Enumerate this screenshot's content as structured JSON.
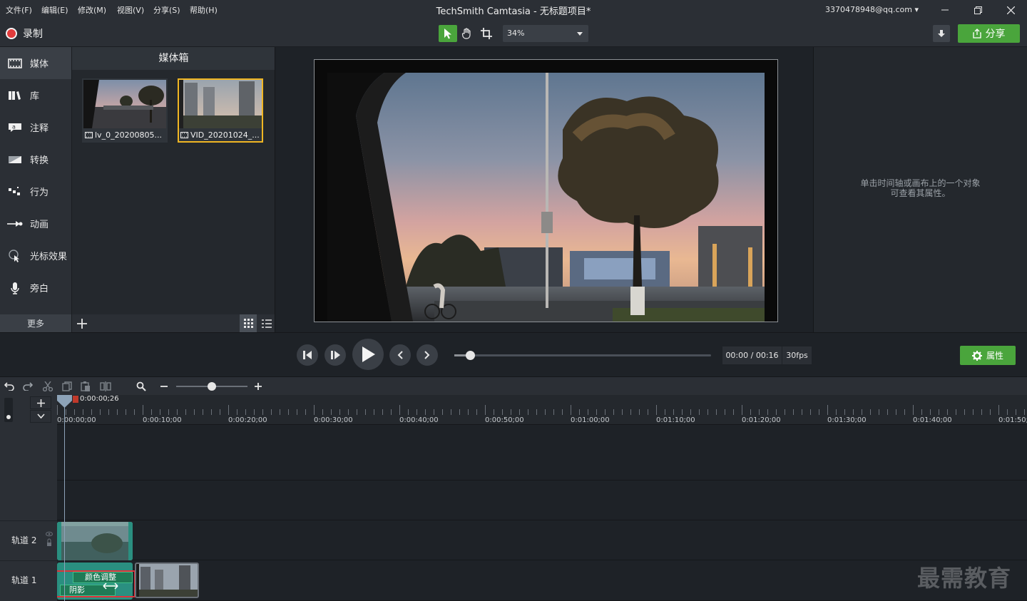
{
  "menubar": {
    "items": [
      "文件(F)",
      "编辑(E)",
      "修改(M)",
      "视图(V)",
      "分享(S)",
      "帮助(H)"
    ],
    "title": "TechSmith Camtasia - 无标题项目*",
    "account": "3370478948@qq.com"
  },
  "toolbar": {
    "record_label": "录制",
    "zoom_value": "34%",
    "share_label": "分享"
  },
  "sidebar": {
    "items": [
      {
        "label": "媒体",
        "icon": "media-icon"
      },
      {
        "label": "库",
        "icon": "library-icon"
      },
      {
        "label": "注释",
        "icon": "annotation-icon"
      },
      {
        "label": "转换",
        "icon": "transition-icon"
      },
      {
        "label": "行为",
        "icon": "behavior-icon"
      },
      {
        "label": "动画",
        "icon": "animation-icon"
      },
      {
        "label": "光标效果",
        "icon": "cursor-effect-icon"
      },
      {
        "label": "旁白",
        "icon": "microphone-icon"
      }
    ],
    "more_label": "更多"
  },
  "media_bin": {
    "title": "媒体箱",
    "items": [
      {
        "caption": "lv_0_20200805..."
      },
      {
        "caption": "VID_20201024_..."
      }
    ]
  },
  "properties": {
    "hint_line1": "单击时间轴或画布上的一个对象",
    "hint_line2": "可查看其属性。",
    "button_label": "属性"
  },
  "playback": {
    "timecode": "00:00 / 00:16",
    "fps": "30fps",
    "progress": 0.06
  },
  "timeline": {
    "zoom_level": 0.5,
    "playhead_time": "0:00:00;26",
    "ruler_labels": [
      "0:00:00;00",
      "0:00:10;00",
      "0:00:20;00",
      "0:00:30;00",
      "0:00:40;00",
      "0:00:50;00",
      "0:01:00;00",
      "0:01:10;00",
      "0:01:20;00",
      "0:01:30;00",
      "0:01:40;00",
      "0:01:50;00"
    ],
    "tracks": [
      {
        "label": "轨道 2"
      },
      {
        "label": "轨道 1"
      }
    ],
    "effects": [
      "颜色调整",
      "阴影"
    ]
  },
  "watermark": "最需教育",
  "colors": {
    "accent_green": "#4aa53c",
    "record_red": "#e23c3c",
    "selection_yellow": "#f0b623",
    "highlight_red": "#e0323a",
    "clip_teal": "#2a8f80"
  }
}
